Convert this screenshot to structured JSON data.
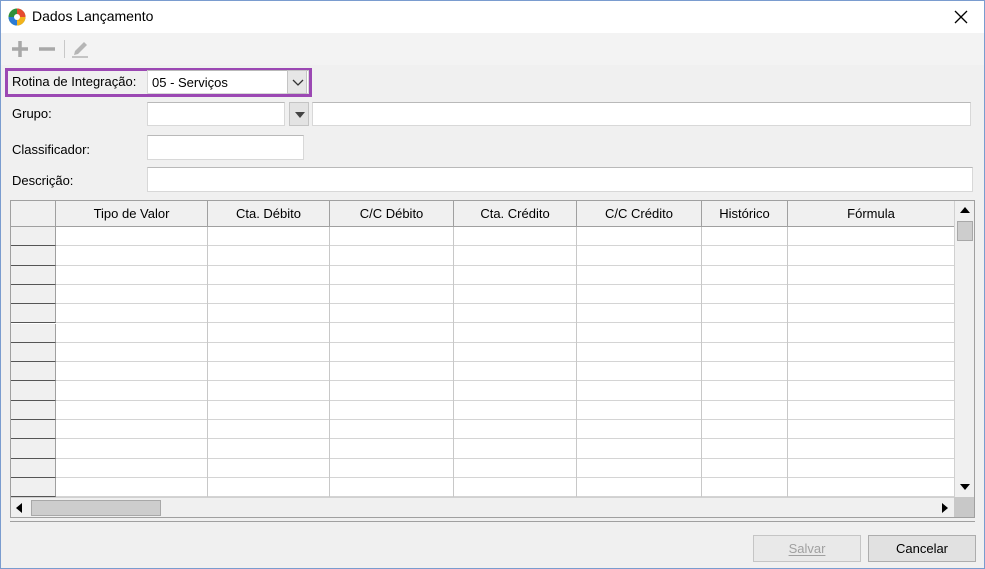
{
  "window": {
    "title": "Dados Lançamento",
    "accent_color": "#9b48b3"
  },
  "toolbar": {
    "add_icon": "plus-icon",
    "remove_icon": "minus-icon",
    "edit_icon": "pencil-icon"
  },
  "form": {
    "rotina_label": "Rotina de Integração:",
    "rotina_value": "05 - Serviços",
    "grupo_label": "Grupo:",
    "grupo_value": "",
    "grupo_desc": "",
    "classificador_label": "Classificador:",
    "classificador_value": "",
    "descricao_label": "Descrição:",
    "descricao_value": ""
  },
  "grid": {
    "columns": [
      "Tipo de Valor",
      "Cta. Débito",
      "C/C Débito",
      "Cta. Crédito",
      "C/C Crédito",
      "Histórico",
      "Fórmula"
    ],
    "row_count": 14
  },
  "buttons": {
    "save_label": "Salvar",
    "cancel_label": "Cancelar"
  }
}
